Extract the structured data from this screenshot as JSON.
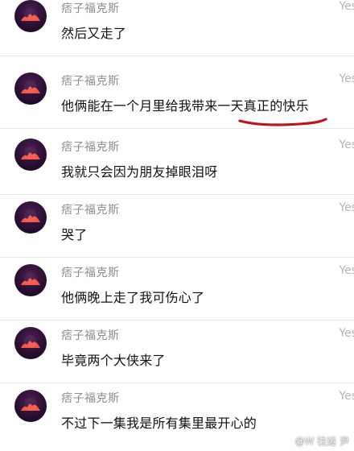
{
  "messages": [
    {
      "username": "痞子福克斯",
      "text": "然后又走了",
      "timestamp": "Yes"
    },
    {
      "username": "痞子福克斯",
      "text": "他俩能在一个月里给我带来一天真正的快乐",
      "timestamp": "Yes"
    },
    {
      "username": "痞子福克斯",
      "text": "我就只会因为朋友掉眼泪呀",
      "timestamp": "Yes"
    },
    {
      "username": "痞子福克斯",
      "text": "哭了",
      "timestamp": "Yes"
    },
    {
      "username": "痞子福克斯",
      "text": "他俩晚上走了我可伤心了",
      "timestamp": "Yes"
    },
    {
      "username": "痞子福克斯",
      "text": "毕竟两个大侠来了",
      "timestamp": "Yes"
    },
    {
      "username": "痞子福克斯",
      "text": "不过下一集我是所有集里最开心的",
      "timestamp": "Yes"
    }
  ],
  "annotation": {
    "underline_color": "#c1121f"
  },
  "watermark": {
    "text": "@W 往运 尹"
  }
}
